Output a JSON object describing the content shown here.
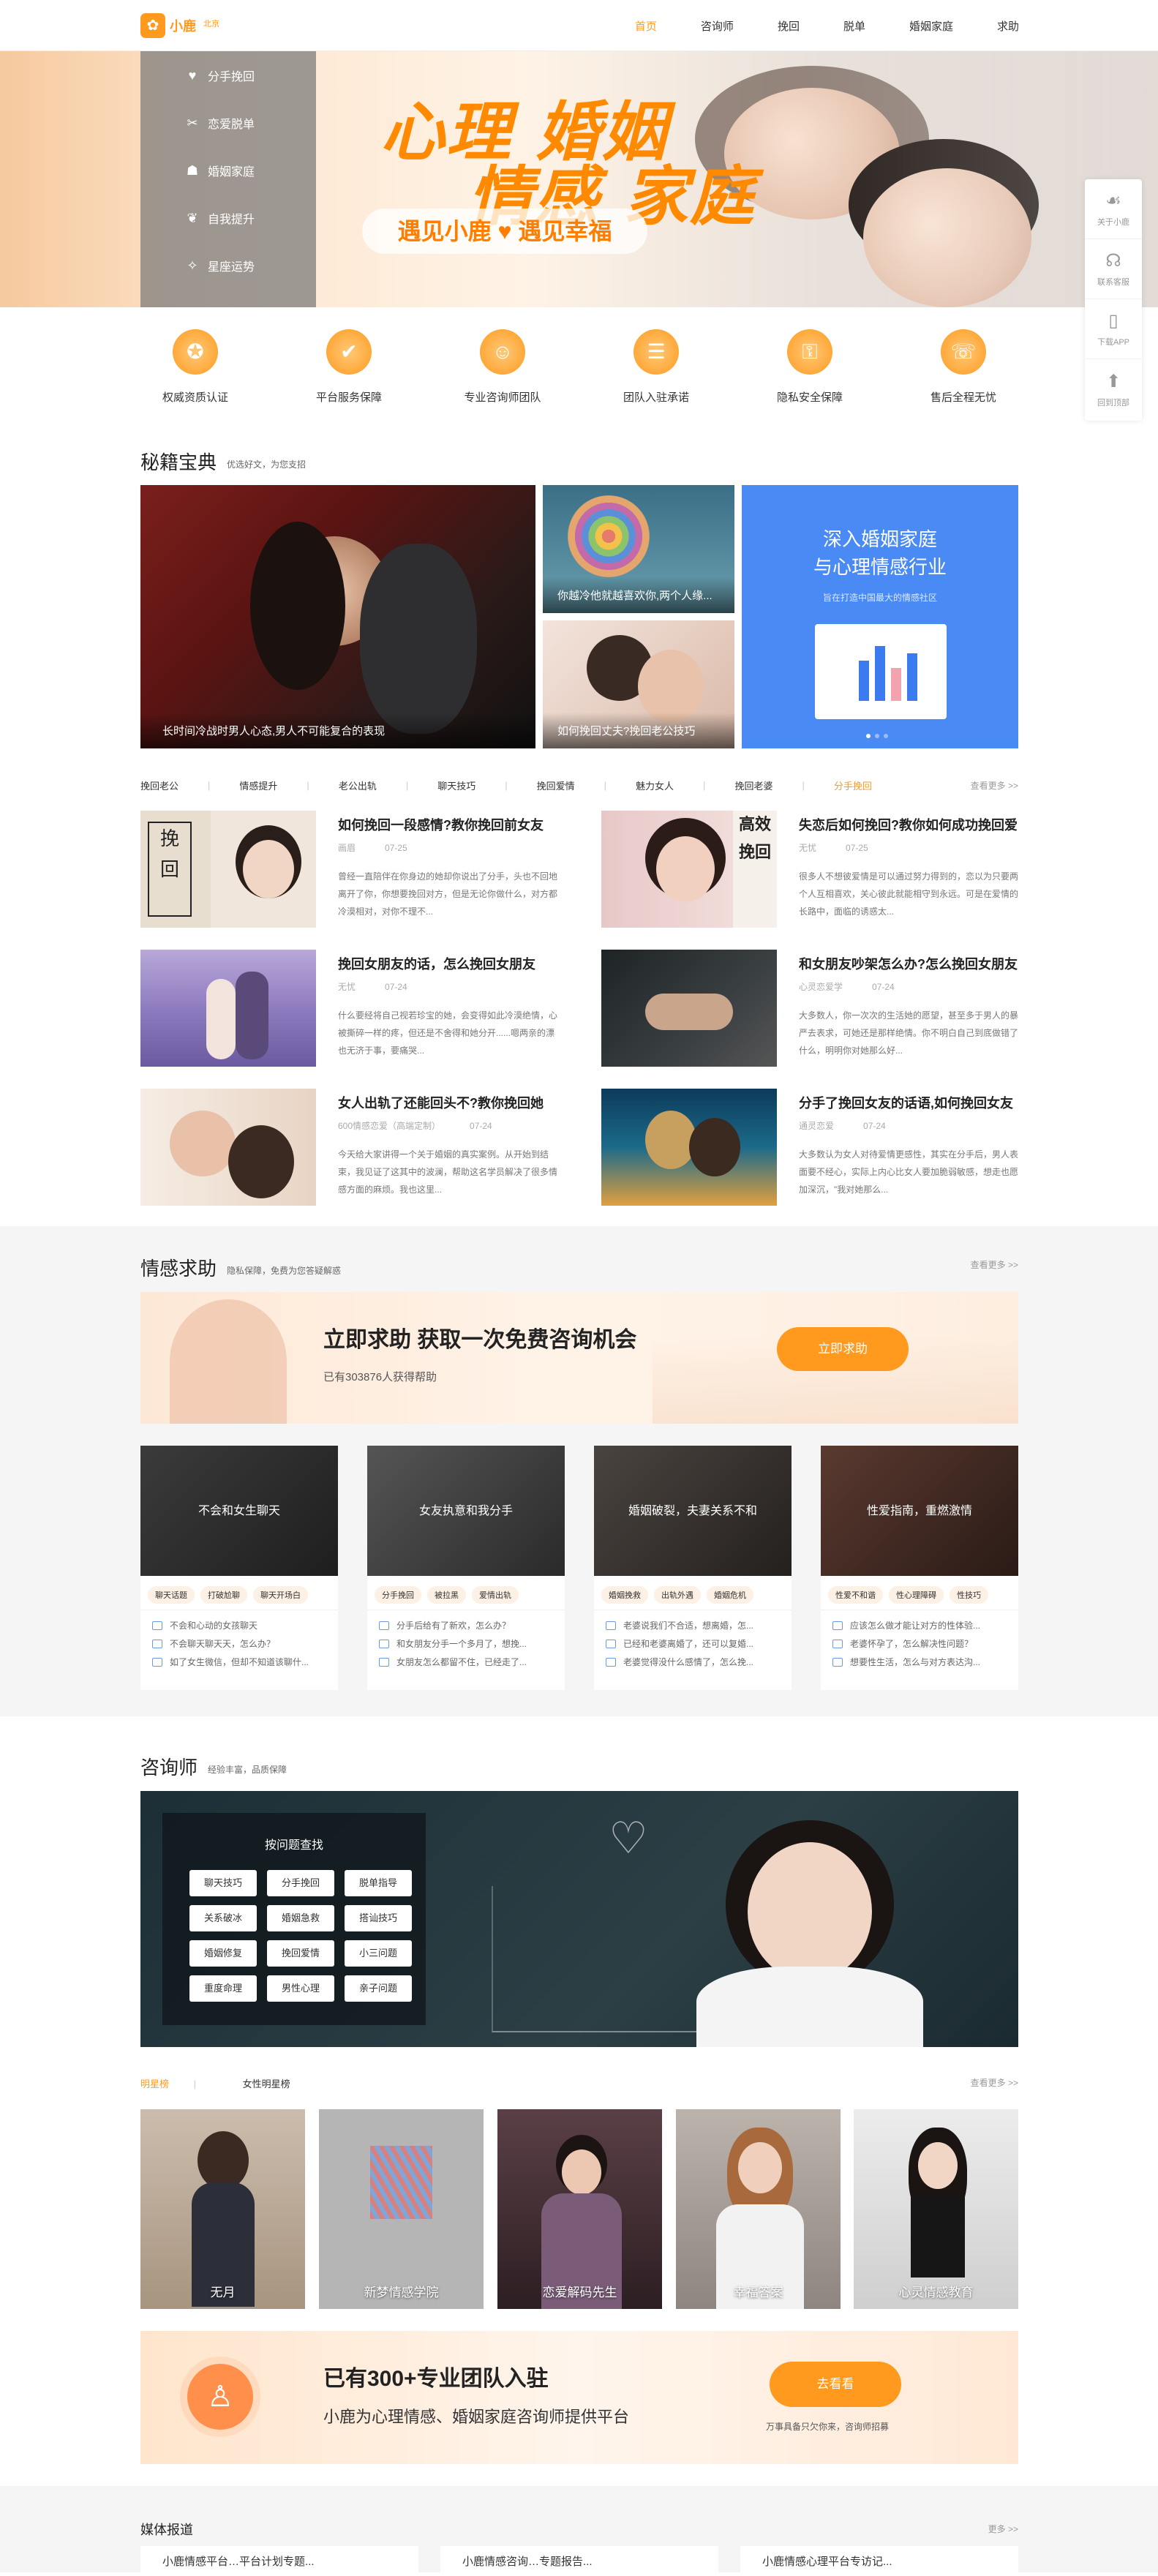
{
  "header": {
    "logo_text": "小鹿",
    "logo_sub": "北京",
    "nav": [
      "首页",
      "咨询师",
      "挽回",
      "脱单",
      "婚姻家庭",
      "求助"
    ]
  },
  "banner": {
    "menu": [
      {
        "label": "分手挽回",
        "icon": "heart-icon"
      },
      {
        "label": "恋爱脱单",
        "icon": "cross-icon"
      },
      {
        "label": "婚姻家庭",
        "icon": "family-icon"
      },
      {
        "label": "自我提升",
        "icon": "leaf-icon"
      },
      {
        "label": "星座运势",
        "icon": "star-icon"
      }
    ],
    "title_line1": "心理 婚姻",
    "title_line2": "情感 家庭",
    "slogan": "遇见小鹿 ♥ 遇见幸福"
  },
  "side_tools": [
    {
      "label": "关于小鹿",
      "icon": "deer-icon"
    },
    {
      "label": "联系客服",
      "icon": "headset-icon"
    },
    {
      "label": "下载APP",
      "icon": "phone-icon"
    },
    {
      "label": "回到顶部",
      "icon": "arrow-up-icon"
    }
  ],
  "features": [
    {
      "label": "权威资质认证",
      "icon": "medal-icon"
    },
    {
      "label": "平台服务保障",
      "icon": "shield-check-icon"
    },
    {
      "label": "专业咨询师团队",
      "icon": "team-icon"
    },
    {
      "label": "团队入驻承诺",
      "icon": "document-icon"
    },
    {
      "label": "隐私安全保障",
      "icon": "lock-shield-icon"
    },
    {
      "label": "售后全程无忧",
      "icon": "support-icon"
    }
  ],
  "secrets": {
    "title": "秘籍宝典",
    "subtitle": "优选好文，为您支招",
    "main_caption": "长时间冷战时男人心态,男人不可能复合的表现",
    "top_caption": "你越冷他就越喜欢你,两个人缘...",
    "bottom_caption": "如何挽回丈夫?挽回老公技巧",
    "promo_line1": "深入婚姻家庭",
    "promo_line2": "与心理情感行业",
    "promo_sub": "旨在打造中国最大的情感社区",
    "tags": [
      "挽回老公",
      "情感提升",
      "老公出轨",
      "聊天技巧",
      "挽回爱情",
      "魅力女人",
      "挽回老婆",
      "分手挽回"
    ],
    "more": "查看更多 >>"
  },
  "articles": [
    {
      "title": "如何挽回一段感情?教你挽回前女友",
      "author": "画眉",
      "date": "07-25",
      "desc": "曾经一直陪伴在你身边的她却你说出了分手，头也不回地离开了你，你想要挽回对方，但是无论你做什么，对方都冷漠相对，对你不理不..."
    },
    {
      "title": "失恋后如何挽回?教你如何成功挽回爱",
      "author": "无忧",
      "date": "07-25",
      "desc": "很多人不想彼爱情是可以通过努力得到的，恋以为只要两个人互相喜欢，关心彼此就能相守到永远。可是在爱情的长路中，面临的诱惑太..."
    },
    {
      "title": "挽回女朋友的话，怎么挽回女朋友",
      "author": "无忧",
      "date": "07-24",
      "desc": "什么要经将自己视若珍宝的她，会变得如此冷漠绝情，心被撕碎一样的疼，但还是不舍得和她分开......嗯两亲的漂也无济于事，要痛哭..."
    },
    {
      "title": "和女朋友吵架怎么办?怎么挽回女朋友",
      "author": "心灵恋爱学",
      "date": "07-24",
      "desc": "大多数人，你一次次的生活她的愿望，甚至多于男人的暴严去表求，可她还是那样绝情。你不明白自己到底做错了什么，明明你对她那么好..."
    },
    {
      "title": "女人出轨了还能回头不?教你挽回她",
      "author": "600情感恋爱（高端定制）",
      "date": "07-24",
      "desc": "今天给大家讲得一个关于婚姻的真实案例。从开始到结束，我见证了这其中的波澜，帮助这名学员解决了很多情感方面的麻烦。我也这里..."
    },
    {
      "title": "分手了挽回女友的话语,如何挽回女友",
      "author": "通灵恋爱",
      "date": "07-24",
      "desc": "大多数认为女人对待爱情更感性，其实在分手后，男人表面要不经心，实际上内心比女人要加脆弱敏感，想走也愿加深沉，\"我对她那么..."
    }
  ],
  "help": {
    "title": "情感求助",
    "subtitle": "隐私保障，免费为您答疑解惑",
    "more": "查看更多 >>",
    "banner_title": "立即求助 获取一次免费咨询机会",
    "banner_sub": "已有303876人获得帮助",
    "banner_btn": "立即求助",
    "cards": [
      {
        "caption": "不会和女生聊天",
        "tags": [
          "聊天话题",
          "打破尬聊",
          "聊天开场白"
        ],
        "qs": [
          "不会和心动的女孩聊天",
          "不会聊天聊天天，怎么办？",
          "如了女生微信，但却不知道该聊什..."
        ]
      },
      {
        "caption": "女友执意和我分手",
        "tags": [
          "分手挽回",
          "被拉黑",
          "爱情出轨"
        ],
        "qs": [
          "分手后给有了新欢，怎么办？",
          "和女朋友分手一个多月了，想挽...",
          "女朋友怎么都留不住，已经走了..."
        ]
      },
      {
        "caption": "婚姻破裂，夫妻关系不和",
        "tags": [
          "婚姻挽救",
          "出轨外遇",
          "婚姻危机"
        ],
        "qs": [
          "老婆说我们不合适，想离婚，怎...",
          "已经和老婆离婚了，还可以复婚...",
          "老婆觉得没什么感情了，怎么挽..."
        ]
      },
      {
        "caption": "性爱指南，重燃激情",
        "tags": [
          "性爱不和谐",
          "性心理障碍",
          "性技巧"
        ],
        "qs": [
          "应该怎么做才能让对方的性体验...",
          "老婆怀孕了，怎么解决性问题？",
          "想要性生活，怎么与对方表达沟..."
        ]
      }
    ]
  },
  "consultants": {
    "title": "咨询师",
    "subtitle": "经验丰富，品质保障",
    "panel_title": "按问题查找",
    "problems": [
      "聊天技巧",
      "分手挽回",
      "脱单指导",
      "关系破冰",
      "婚姻急救",
      "搭讪技巧",
      "婚姻修复",
      "挽回爱情",
      "小三问题",
      "重度命理",
      "男性心理",
      "亲子问题"
    ],
    "tabs": [
      "明星榜",
      "女性明星榜"
    ],
    "more": "查看更多 >>",
    "cards": [
      "无月",
      "新梦情感学院",
      "恋爱解码先生",
      "幸福答案",
      "心灵情感教育"
    ],
    "team_title": "已有300+专业团队入驻",
    "team_sub": "小鹿为心理情感、婚姻家庭咨询师提供平台",
    "team_btn": "去看看",
    "team_note": "万事具备只欠你来，咨询师招募"
  },
  "media": {
    "title": "媒体报道",
    "more": "更多 >>",
    "items": [
      "小鹿情感平台…平台计划专题...",
      "小鹿情感咨询…专题报告...",
      "小鹿情感心理平台专访记..."
    ]
  }
}
